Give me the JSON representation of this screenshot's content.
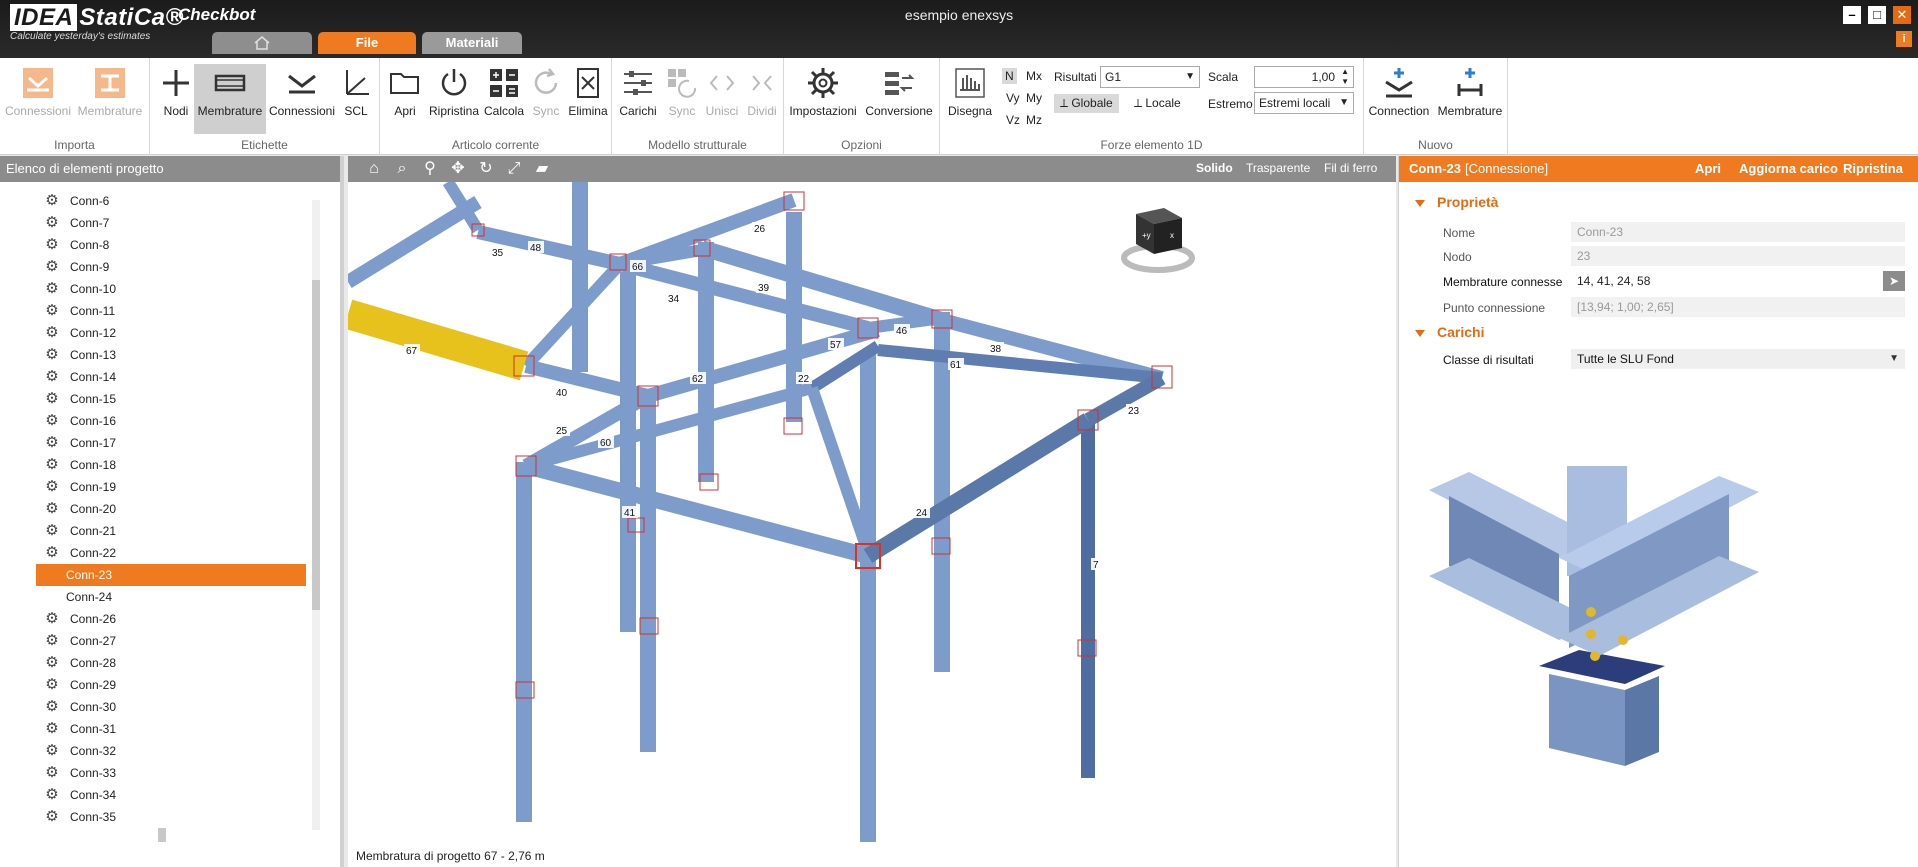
{
  "app": {
    "logo_idea": "IDEA",
    "logo_statica": "StatiCa®",
    "tagline": "Calculate yesterday's estimates",
    "product": "Checkbot",
    "document_title": "esempio enexsys",
    "window_controls": {
      "minimize": "–",
      "maximize": "□",
      "close": "✕"
    },
    "help": "i"
  },
  "tabs": [
    {
      "label": ""
    },
    {
      "label": "File"
    },
    {
      "label": "Materiali"
    }
  ],
  "ribbon": {
    "importa": {
      "label": "Importa",
      "buttons": [
        "Connessioni",
        "Membrature"
      ]
    },
    "etichette": {
      "label": "Etichette",
      "buttons": [
        "Nodi",
        "Membrature",
        "Connessioni",
        "SCL"
      ]
    },
    "articolo": {
      "label": "Articolo corrente",
      "buttons": [
        "Apri",
        "Ripristina",
        "Calcola",
        "Sync",
        "Elimina"
      ]
    },
    "modello": {
      "label": "Modello strutturale",
      "buttons": [
        "Carichi",
        "Sync",
        "Unisci",
        "Dividi"
      ]
    },
    "opzioni": {
      "label": "Opzioni",
      "buttons": [
        "Impostazioni",
        "Conversione"
      ]
    },
    "forze": {
      "label": "Forze elemento 1D",
      "disegna": "Disegna",
      "components": [
        "N",
        "Mx",
        "Vy",
        "My",
        "Vz",
        "Mz"
      ],
      "risultati_label": "Risultati",
      "risultati_value": "G1",
      "globale": "Globale",
      "locale": "Locale",
      "scala_label": "Scala",
      "scala_value": "1,00",
      "estremo_label": "Estremo",
      "estremo_value": "Estremi locali"
    },
    "nuovo": {
      "label": "Nuovo",
      "buttons": [
        "Connection",
        "Membrature"
      ]
    }
  },
  "left_panel": {
    "title": "Elenco di elementi progetto",
    "items": [
      {
        "label": "Conn-6",
        "gear": true
      },
      {
        "label": "Conn-7",
        "gear": true
      },
      {
        "label": "Conn-8",
        "gear": true
      },
      {
        "label": "Conn-9",
        "gear": true
      },
      {
        "label": "Conn-10",
        "gear": true
      },
      {
        "label": "Conn-11",
        "gear": true
      },
      {
        "label": "Conn-12",
        "gear": true
      },
      {
        "label": "Conn-13",
        "gear": true
      },
      {
        "label": "Conn-14",
        "gear": true
      },
      {
        "label": "Conn-15",
        "gear": true
      },
      {
        "label": "Conn-16",
        "gear": true
      },
      {
        "label": "Conn-17",
        "gear": true
      },
      {
        "label": "Conn-18",
        "gear": true
      },
      {
        "label": "Conn-19",
        "gear": true
      },
      {
        "label": "Conn-20",
        "gear": true
      },
      {
        "label": "Conn-21",
        "gear": true
      },
      {
        "label": "Conn-22",
        "gear": true
      },
      {
        "label": "Conn-23",
        "gear": false,
        "selected": true
      },
      {
        "label": "Conn-24",
        "gear": false
      },
      {
        "label": "Conn-26",
        "gear": true
      },
      {
        "label": "Conn-27",
        "gear": true
      },
      {
        "label": "Conn-28",
        "gear": true
      },
      {
        "label": "Conn-29",
        "gear": true
      },
      {
        "label": "Conn-30",
        "gear": true
      },
      {
        "label": "Conn-31",
        "gear": true
      },
      {
        "label": "Conn-32",
        "gear": true
      },
      {
        "label": "Conn-33",
        "gear": true
      },
      {
        "label": "Conn-34",
        "gear": true
      },
      {
        "label": "Conn-35",
        "gear": true
      }
    ]
  },
  "viewport": {
    "modes": [
      "Solido",
      "Trasparente",
      "Fil di ferro"
    ],
    "active_mode": "Solido",
    "status": "Membratura di progetto 67 - 2,76 m",
    "member_labels": [
      "35",
      "48",
      "26",
      "66",
      "39",
      "34",
      "67",
      "40",
      "46",
      "57",
      "38",
      "61",
      "62",
      "22",
      "25",
      "60",
      "23",
      "41",
      "24",
      "7"
    ],
    "cube_labels": [
      "+y",
      "x"
    ]
  },
  "right_panel": {
    "title": "Conn-23",
    "type": "[Connessione]",
    "actions": [
      "Apri",
      "Aggiorna carico",
      "Ripristina"
    ],
    "proprieta": {
      "label": "Proprietà",
      "nome_label": "Nome",
      "nome_value": "Conn-23",
      "nodo_label": "Nodo",
      "nodo_value": "23",
      "membrature_label": "Membrature connesse",
      "membrature_value": "14, 41, 24, 58",
      "punto_label": "Punto connessione",
      "punto_value": "[13,94; 1,00; 2,65]"
    },
    "carichi": {
      "label": "Carichi",
      "classe_label": "Classe di risultati",
      "classe_value": "Tutte le SLU Fond"
    }
  },
  "colors": {
    "accent": "#f07a1f",
    "steel": "#8aa8d4",
    "steel_dark": "#5a78a8",
    "highlight_member": "#e8c21c"
  }
}
